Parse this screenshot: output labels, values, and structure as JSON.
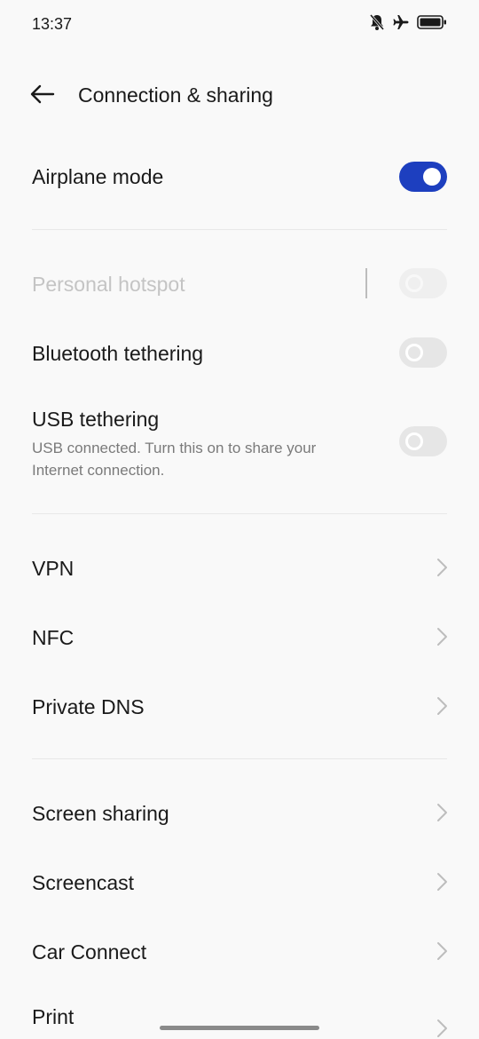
{
  "status_bar": {
    "time": "13:37",
    "icons": [
      "bell-muted-icon",
      "airplane-icon",
      "battery-icon"
    ]
  },
  "header": {
    "title": "Connection & sharing",
    "back_icon": "arrow-left-icon"
  },
  "sections": {
    "airplane": {
      "label": "Airplane mode",
      "toggle_on": true
    },
    "hotspot": {
      "label": "Personal hotspot",
      "toggle_on": false,
      "disabled": true
    },
    "bluetooth": {
      "label": "Bluetooth tethering",
      "toggle_on": false
    },
    "usb": {
      "label": "USB tethering",
      "subtitle": "USB connected. Turn this on to share your Internet connection.",
      "toggle_on": false
    },
    "vpn": {
      "label": "VPN"
    },
    "nfc": {
      "label": "NFC"
    },
    "private_dns": {
      "label": "Private DNS"
    },
    "screen_sharing": {
      "label": "Screen sharing"
    },
    "screencast": {
      "label": "Screencast"
    },
    "car_connect": {
      "label": "Car Connect"
    },
    "print": {
      "label": "Print"
    }
  },
  "colors": {
    "accent": "#1d3fbf",
    "background": "#f9f9f9",
    "text": "#1a1a1a",
    "subtext": "#7a7a7a",
    "disabled": "#c4c4c4"
  }
}
